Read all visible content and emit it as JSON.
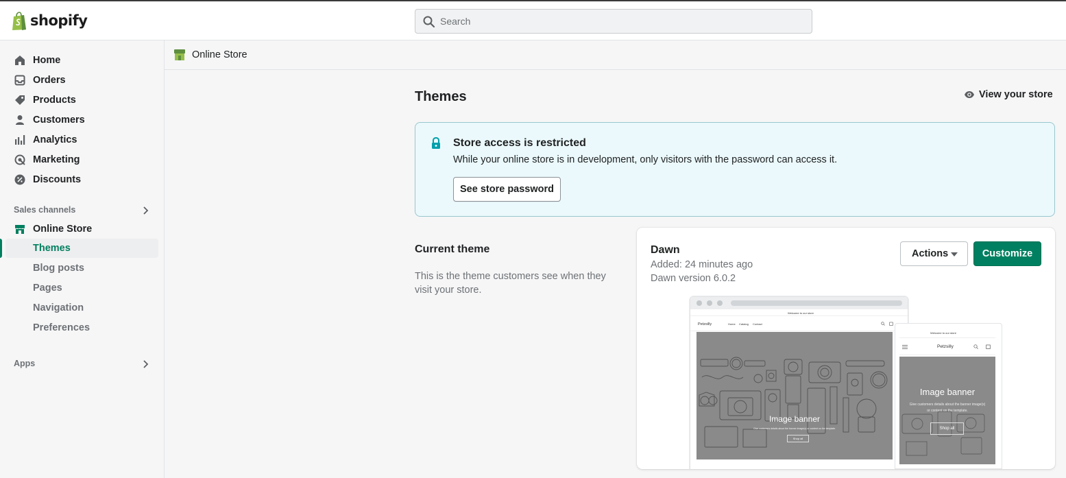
{
  "brand": {
    "name": "shopify",
    "accent": "#008060",
    "active_color": "#007f5f"
  },
  "search": {
    "placeholder": "Search",
    "value": ""
  },
  "sidebar": {
    "items": [
      {
        "label": "Home",
        "icon": "home-icon"
      },
      {
        "label": "Orders",
        "icon": "inbox-icon"
      },
      {
        "label": "Products",
        "icon": "tag-icon"
      },
      {
        "label": "Customers",
        "icon": "person-icon"
      },
      {
        "label": "Analytics",
        "icon": "bar-chart-icon"
      },
      {
        "label": "Marketing",
        "icon": "target-icon"
      },
      {
        "label": "Discounts",
        "icon": "discount-icon"
      }
    ],
    "sales_channels_label": "Sales channels",
    "online_store_label": "Online Store",
    "sub_items": [
      {
        "label": "Themes",
        "active": true
      },
      {
        "label": "Blog posts",
        "active": false
      },
      {
        "label": "Pages",
        "active": false
      },
      {
        "label": "Navigation",
        "active": false
      },
      {
        "label": "Preferences",
        "active": false
      }
    ],
    "apps_label": "Apps"
  },
  "breadcrumb": {
    "label": "Online Store"
  },
  "page": {
    "title": "Themes",
    "view_store_label": "View your store"
  },
  "banner": {
    "title": "Store access is restricted",
    "text": "While your online store is in development, only visitors with the password can access it.",
    "button_label": "See store password"
  },
  "current_theme": {
    "heading": "Current theme",
    "description": "This is the theme customers see when they visit your store.",
    "name": "Dawn",
    "added": "Added: 24 minutes ago",
    "version": "Dawn version 6.0.2",
    "actions_label": "Actions",
    "customize_label": "Customize"
  },
  "preview": {
    "desktop_announcement": "Welcome to our store",
    "store_name": "Petzsilly",
    "desktop_nav": [
      "Home",
      "Catalog",
      "Contact"
    ],
    "banner_title": "Image banner",
    "banner_subtitle": "Give customers details about the banner image(s) or content on the template.",
    "shop_all_label": "Shop all",
    "mobile_announcement": "Welcome to our store"
  }
}
